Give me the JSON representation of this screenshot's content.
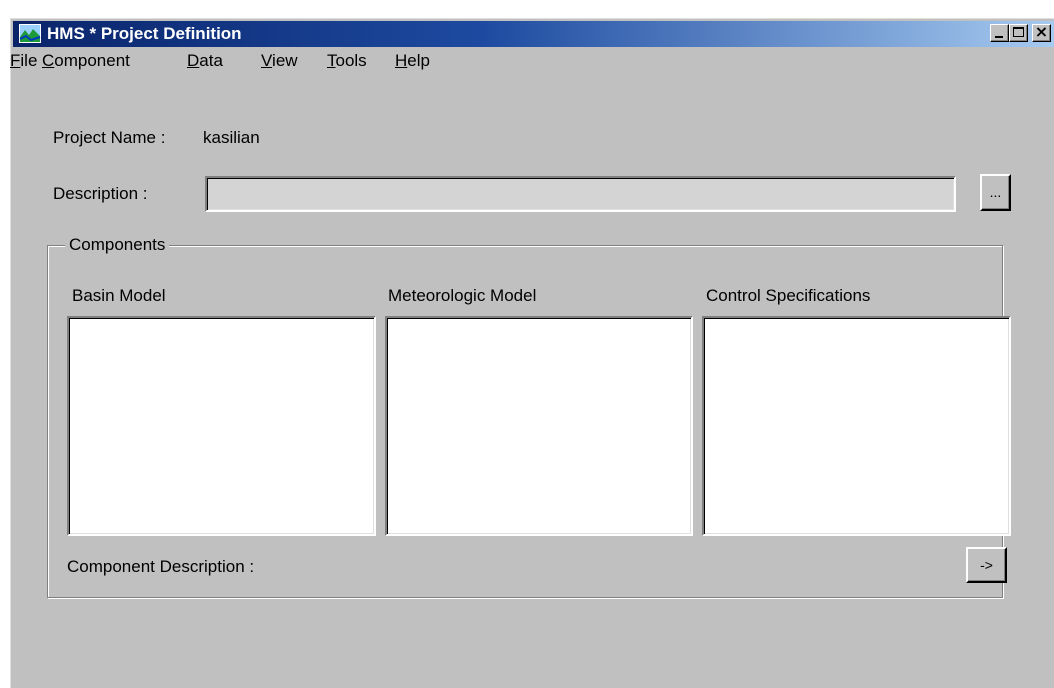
{
  "window": {
    "title": "HMS * Project Definition"
  },
  "menu": {
    "file": {
      "mnemonic": "F",
      "rest": "ile"
    },
    "component": {
      "mnemonic": "C",
      "rest": "omponent"
    },
    "data": {
      "mnemonic": "D",
      "rest": "ata"
    },
    "view": {
      "mnemonic": "V",
      "rest": "iew"
    },
    "tools": {
      "mnemonic": "T",
      "rest": "ools"
    },
    "help": {
      "mnemonic": "H",
      "rest": "elp"
    }
  },
  "project": {
    "name_label": "Project Name :",
    "name_value": "kasilian",
    "description_label": "Description :",
    "description_value": "",
    "browse_label": "..."
  },
  "components": {
    "group_label": "Components",
    "basin_label": "Basin Model",
    "meteorologic_label": "Meteorologic Model",
    "control_label": "Control Specifications",
    "component_description_label": "Component Description :",
    "arrow_button_label": "->"
  },
  "icons": {
    "app": "hms-landscape-icon",
    "minimize": "minimize-icon",
    "maximize": "maximize-icon",
    "close": "close-icon"
  }
}
